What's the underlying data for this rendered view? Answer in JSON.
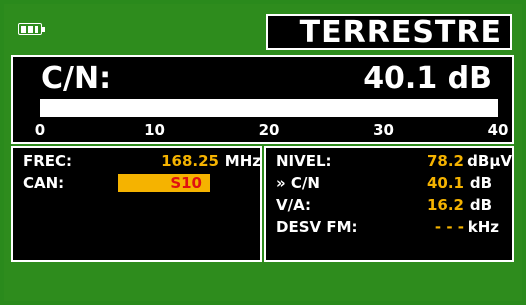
{
  "header": {
    "title": "TERRESTRE",
    "battery_icon": "battery-icon"
  },
  "measure": {
    "label": "C/N:",
    "value": "40.1 dB",
    "bar_percent": 100,
    "scale": [
      "0",
      "10",
      "20",
      "30",
      "40"
    ]
  },
  "left_panel": {
    "frec_label": "FREC:",
    "frec_value": "168.25",
    "frec_unit": "MHz",
    "can_label": "CAN:",
    "can_value": "S10"
  },
  "right_panel": {
    "nivel_label": "NIVEL:",
    "nivel_value": "78.2",
    "nivel_unit": "dBµV",
    "cn_label": "» C/N",
    "cn_value": "40.1",
    "cn_unit": "dB",
    "va_label": "V/A:",
    "va_value": "16.2",
    "va_unit": "dB",
    "desv_label": "DESV FM:",
    "desv_value": "- - -",
    "desv_unit": "kHz"
  },
  "colors": {
    "background": "#2e8c1d",
    "value": "#f5b300",
    "selection": "#f5b300",
    "selected_text": "#e01010"
  }
}
